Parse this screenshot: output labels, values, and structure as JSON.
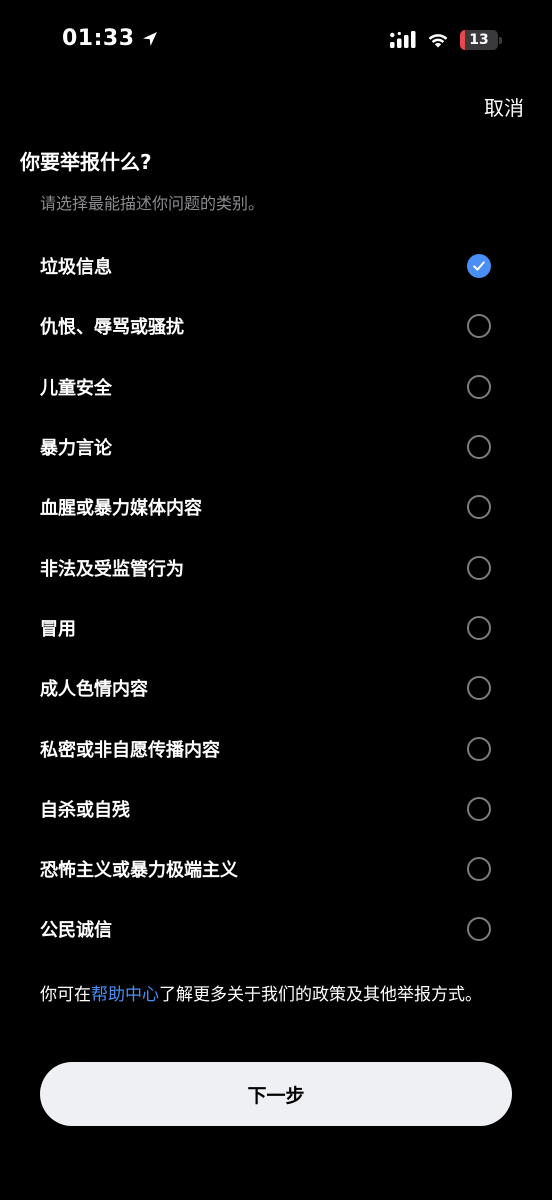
{
  "status_bar": {
    "time": "01:33",
    "battery_level": "13",
    "battery_fraction": 0.13,
    "battery_color": "#e5484d"
  },
  "header": {
    "cancel_label": "取消",
    "title": "你要举报什么?",
    "subtitle": "请选择最能描述你问题的类别。"
  },
  "options": [
    {
      "label": "垃圾信息",
      "checked": true
    },
    {
      "label": "仇恨、辱骂或骚扰",
      "checked": false
    },
    {
      "label": "儿童安全",
      "checked": false
    },
    {
      "label": "暴力言论",
      "checked": false
    },
    {
      "label": "血腥或暴力媒体内容",
      "checked": false
    },
    {
      "label": "非法及受监管行为",
      "checked": false
    },
    {
      "label": "冒用",
      "checked": false
    },
    {
      "label": "成人色情内容",
      "checked": false
    },
    {
      "label": "私密或非自愿传播内容",
      "checked": false
    },
    {
      "label": "自杀或自残",
      "checked": false
    },
    {
      "label": "恐怖主义或暴力极端主义",
      "checked": false
    },
    {
      "label": "公民诚信",
      "checked": false
    }
  ],
  "footer": {
    "help_prefix": "你可在",
    "help_link": "帮助中心",
    "help_suffix": "了解更多关于我们的政策及其他举报方式。",
    "next_label": "下一步"
  },
  "colors": {
    "accent": "#4a8ff5",
    "background": "#000000",
    "button_bg": "#eff0f3"
  }
}
